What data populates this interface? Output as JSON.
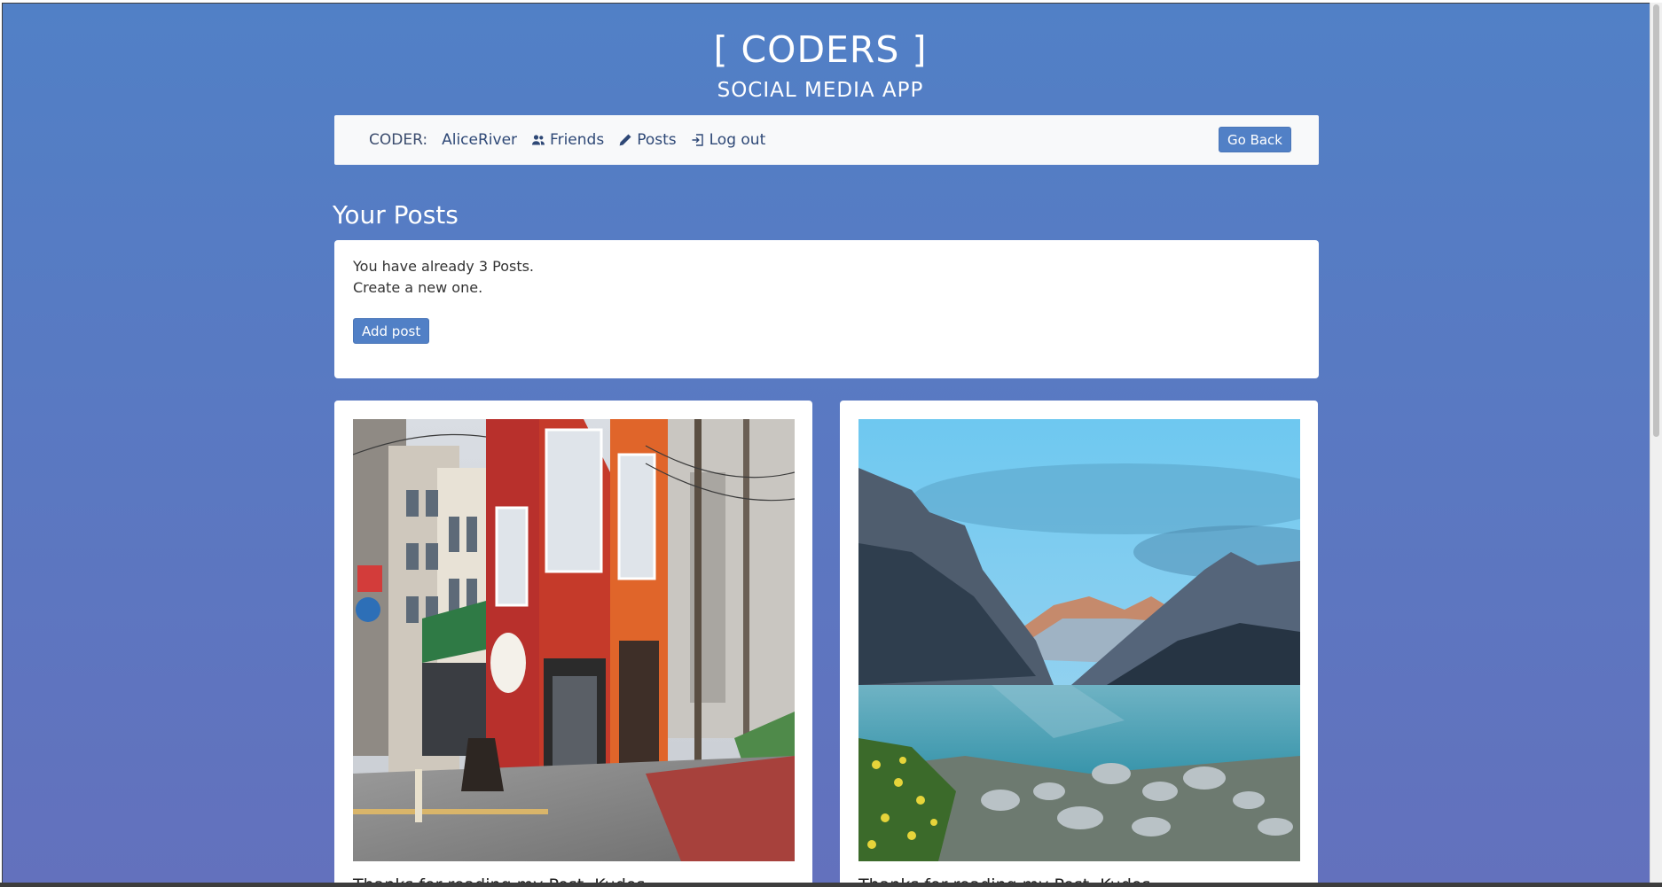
{
  "brand": {
    "title": "[ CODERS ]",
    "subtitle": "SOCIAL MEDIA APP"
  },
  "nav": {
    "coder_label": "CODER:",
    "username": "AliceRiver",
    "friends": "Friends",
    "posts": "Posts",
    "logout": "Log out",
    "go_back": "Go Back"
  },
  "page": {
    "heading": "Your Posts"
  },
  "info": {
    "count_text": "You have already 3 Posts.",
    "prompt_text": "Create a new one.",
    "add_button": "Add post"
  },
  "posts": [
    {
      "caption": "Thanks for reading my Post. Kudos",
      "image": "japanese-street-corner-red-building"
    },
    {
      "caption": "Thanks for reading my Post. Kudos",
      "image": "mountain-lake-reflection"
    }
  ],
  "colors": {
    "background_top": "#5180c6",
    "background_bottom": "#6371bd",
    "button": "#5180c6",
    "navbar": "#f8f9fa"
  },
  "icons": {
    "friends": "users-icon",
    "posts": "pencil-icon",
    "logout": "sign-out-icon"
  }
}
